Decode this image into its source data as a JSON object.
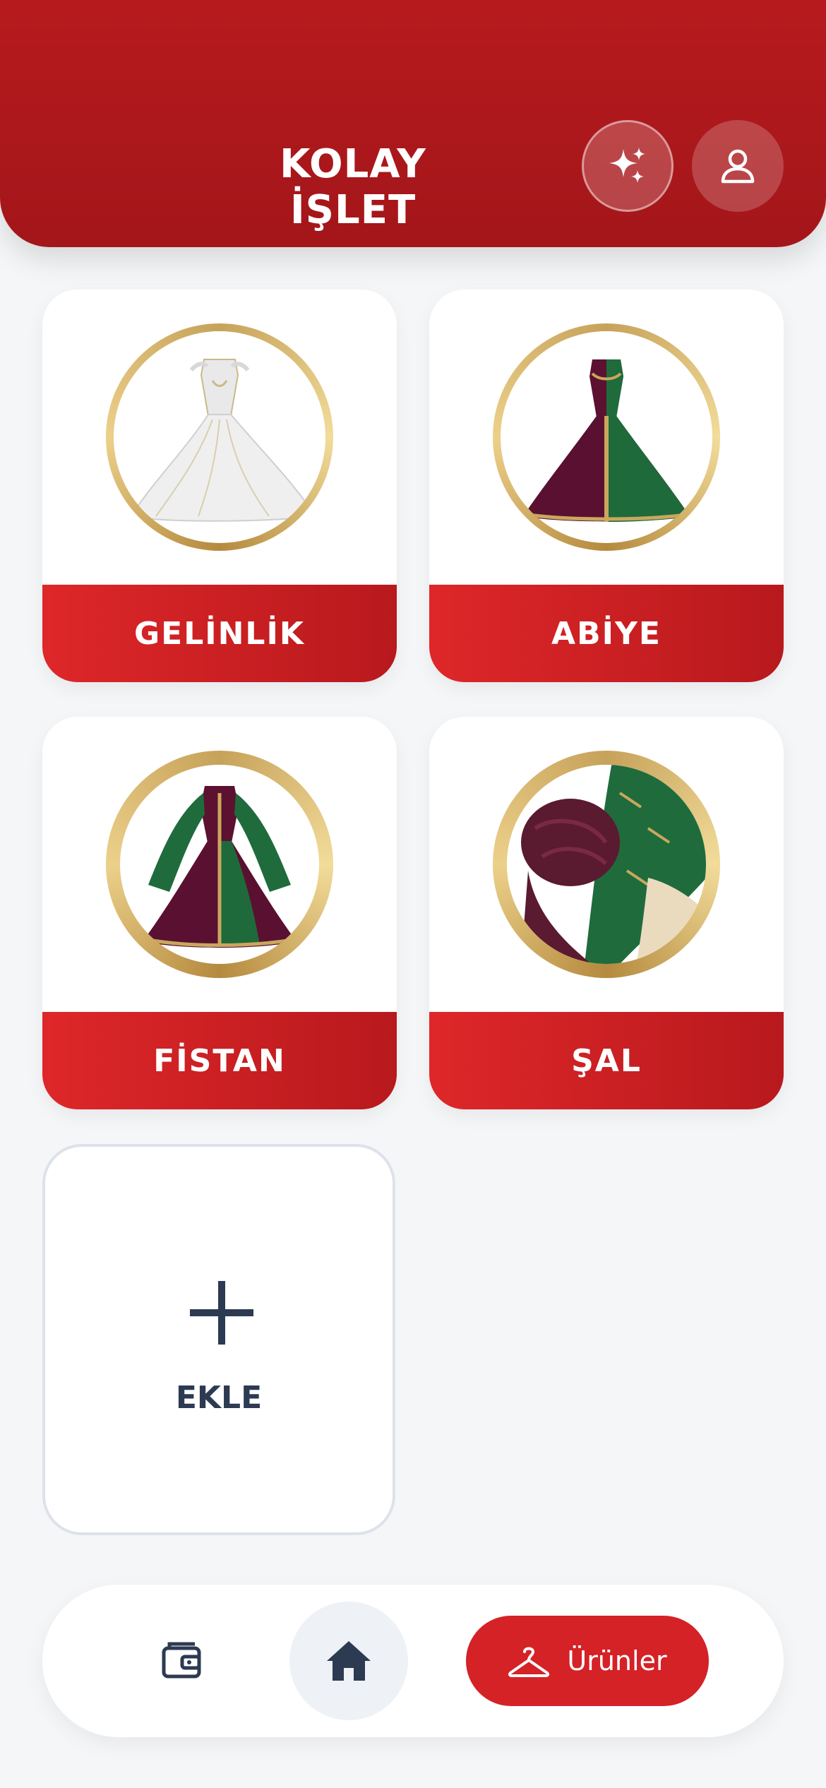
{
  "header": {
    "title": "KOLAY İŞLET",
    "actions": [
      "sparkles-icon",
      "profile-icon"
    ]
  },
  "categories": [
    {
      "label": "GELİNLİK",
      "icon": "wedding-dress-image"
    },
    {
      "label": "ABİYE",
      "icon": "evening-gown-image"
    },
    {
      "label": "FİSTAN",
      "icon": "kaftan-dress-image"
    },
    {
      "label": "ŞAL",
      "icon": "shawl-image"
    }
  ],
  "add_card": {
    "label": "EKLE",
    "icon": "plus-icon"
  },
  "bottom_nav": {
    "wallet_icon": "wallet-icon",
    "home_icon": "home-icon",
    "products_label": "Ürünler",
    "products_icon": "hanger-icon"
  },
  "colors": {
    "header_red": "#b71a1d",
    "accent_red": "#d42226",
    "dark_text": "#2c3a52",
    "gold": "#c7a25a",
    "background": "#f5f6f8"
  }
}
